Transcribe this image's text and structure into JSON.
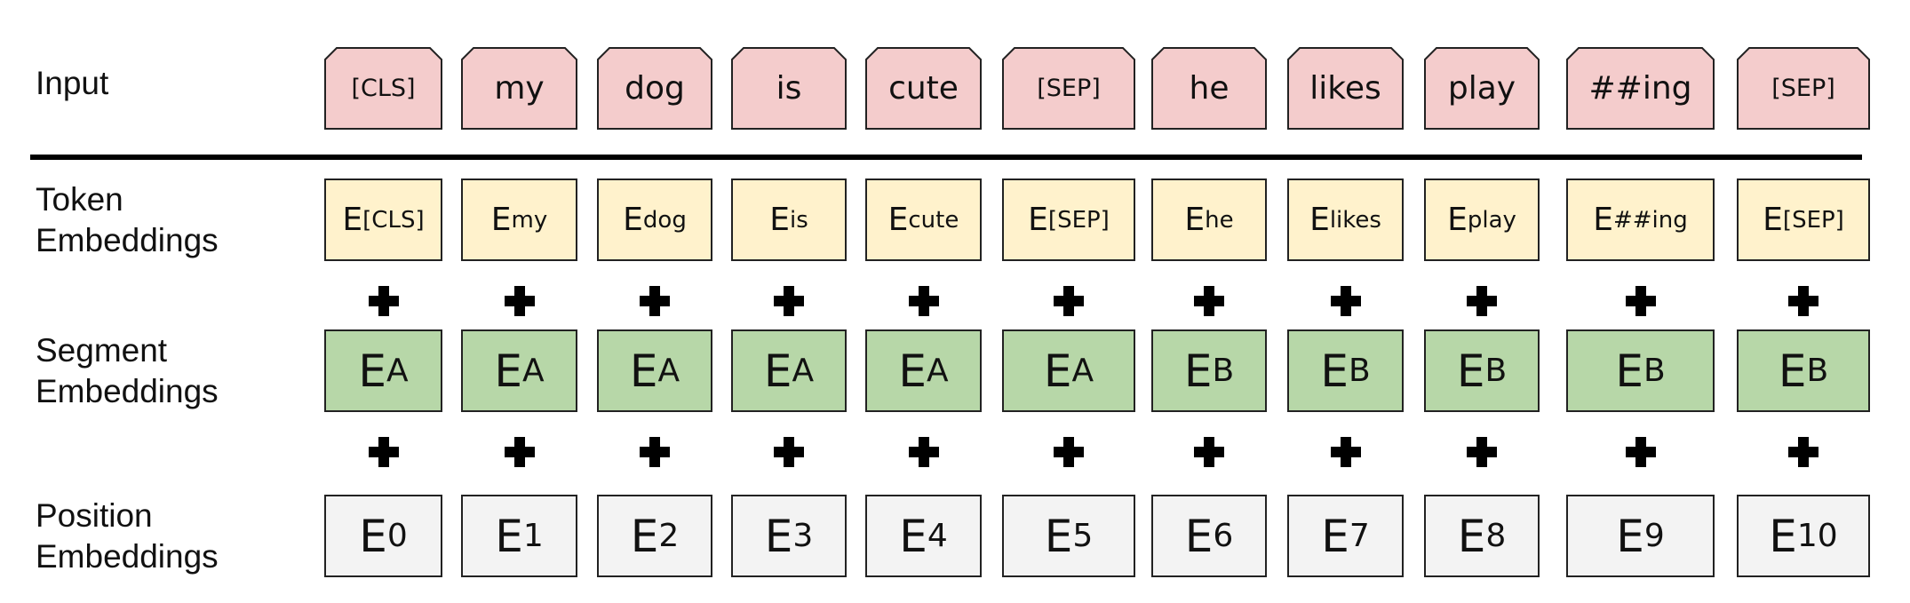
{
  "labels": {
    "input": "Input",
    "token": [
      "Token",
      "Embeddings"
    ],
    "segment": [
      "Segment",
      "Embeddings"
    ],
    "position": [
      "Position",
      "Embeddings"
    ]
  },
  "tokens": [
    "[CLS]",
    "my",
    "dog",
    "is",
    "cute",
    "[SEP]",
    "he",
    "likes",
    "play",
    "##ing",
    "[SEP]"
  ],
  "token_embeddings": [
    "[CLS]",
    "my",
    "dog",
    "is",
    "cute",
    "[SEP]",
    "he",
    "likes",
    "play",
    "##ing",
    "[SEP]"
  ],
  "segment_embeddings": [
    "A",
    "A",
    "A",
    "A",
    "A",
    "A",
    "B",
    "B",
    "B",
    "B",
    "B"
  ],
  "position_embeddings": [
    "0",
    "1",
    "2",
    "3",
    "4",
    "5",
    "6",
    "7",
    "8",
    "9",
    "10"
  ],
  "embedding_symbol": "E",
  "colors": {
    "input_fill": "#f4cccc",
    "token_fill": "#fff2cc",
    "segment_fill": "#b7d7a8",
    "position_fill": "#f3f3f3",
    "stroke": "#222222"
  }
}
